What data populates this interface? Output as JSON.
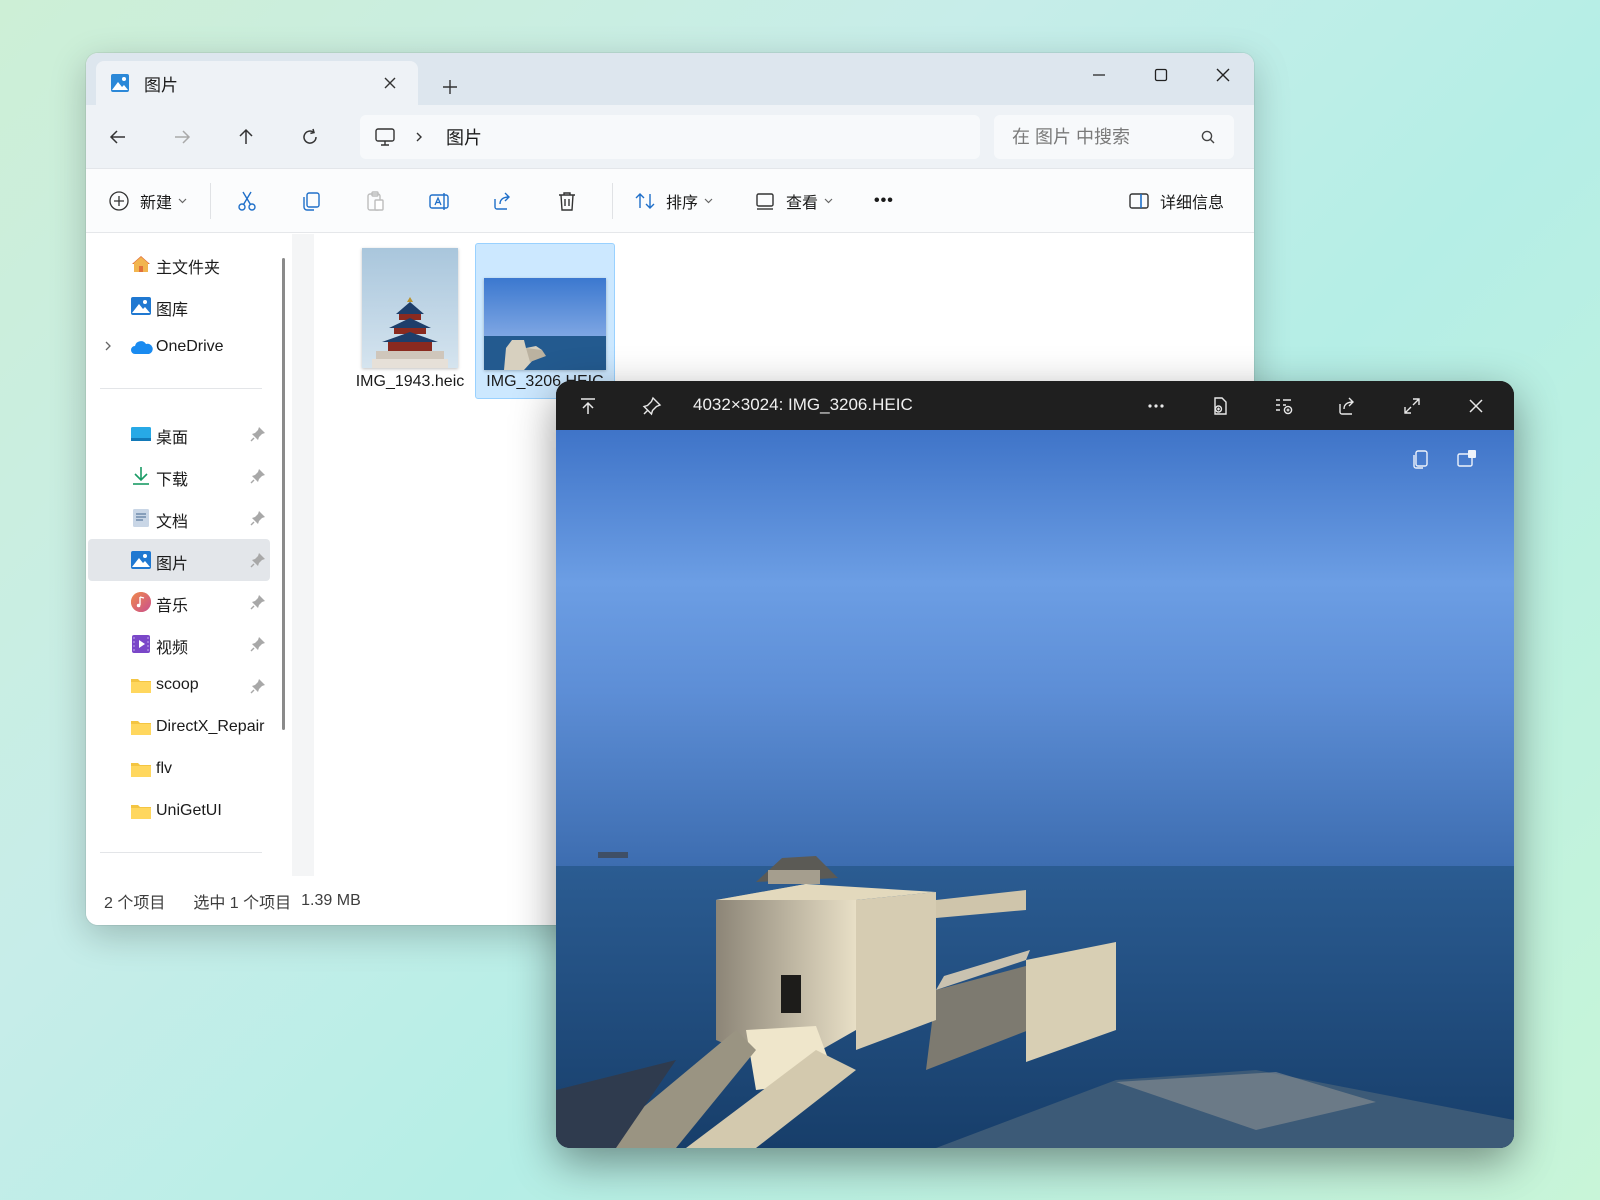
{
  "explorer": {
    "tab": {
      "title": "图片",
      "icon": "pictures-folder-icon"
    },
    "new_tab_icon": "plus-icon",
    "window_controls": [
      "minimize-icon",
      "maximize-icon",
      "close-icon"
    ],
    "nav": {
      "back": "arrow-left-icon",
      "forward": "arrow-right-icon",
      "up": "arrow-up-icon",
      "refresh": "refresh-icon"
    },
    "address": {
      "root_icon": "this-pc-icon",
      "crumb": "图片"
    },
    "search": {
      "placeholder": "在 图片 中搜索"
    },
    "toolbar": {
      "new_label": "新建",
      "sort_label": "排序",
      "view_label": "查看",
      "more_label": "•••",
      "details_label": "详细信息"
    },
    "sidebar": {
      "top": [
        {
          "label": "主文件夹",
          "icon": "home-icon"
        },
        {
          "label": "图库",
          "icon": "gallery-icon"
        },
        {
          "label": "OneDrive",
          "icon": "onedrive-icon"
        }
      ],
      "quick": [
        {
          "label": "桌面",
          "icon": "desktop-icon",
          "pinned": true
        },
        {
          "label": "下载",
          "icon": "download-icon",
          "pinned": true
        },
        {
          "label": "文档",
          "icon": "documents-icon",
          "pinned": true
        },
        {
          "label": "图片",
          "icon": "pictures-icon",
          "pinned": true,
          "selected": true
        },
        {
          "label": "音乐",
          "icon": "music-icon",
          "pinned": true
        },
        {
          "label": "视频",
          "icon": "videos-icon",
          "pinned": true
        },
        {
          "label": "scoop",
          "icon": "folder-icon",
          "pinned": true
        },
        {
          "label": "DirectX_Repair",
          "icon": "folder-icon",
          "pinned": false
        },
        {
          "label": "flv",
          "icon": "folder-icon",
          "pinned": false
        },
        {
          "label": "UniGetUI",
          "icon": "folder-icon",
          "pinned": false
        }
      ]
    },
    "files": [
      {
        "name": "IMG_1943.heic",
        "selected": false
      },
      {
        "name": "IMG_3206.HEIC",
        "selected": true
      }
    ],
    "status": {
      "count": "2 个项目",
      "selection": "选中 1 个项目",
      "size": "1.39 MB"
    }
  },
  "viewer": {
    "title": "4032×3024: IMG_3206.HEIC",
    "toolbar_icons": [
      "pin-top-icon",
      "pin-icon",
      "more-icon",
      "open-with-icon",
      "file-info-icon",
      "share-icon",
      "fullscreen-icon",
      "close-icon"
    ],
    "overlay_icons": [
      "copy-icon",
      "compare-icon"
    ]
  },
  "colors": {
    "accent": "#0067c0",
    "selection": "#cce8ff",
    "viewer_bg": "#1f1f1f",
    "sky": "#5d8ed6",
    "sea": "#1f4f7d"
  }
}
